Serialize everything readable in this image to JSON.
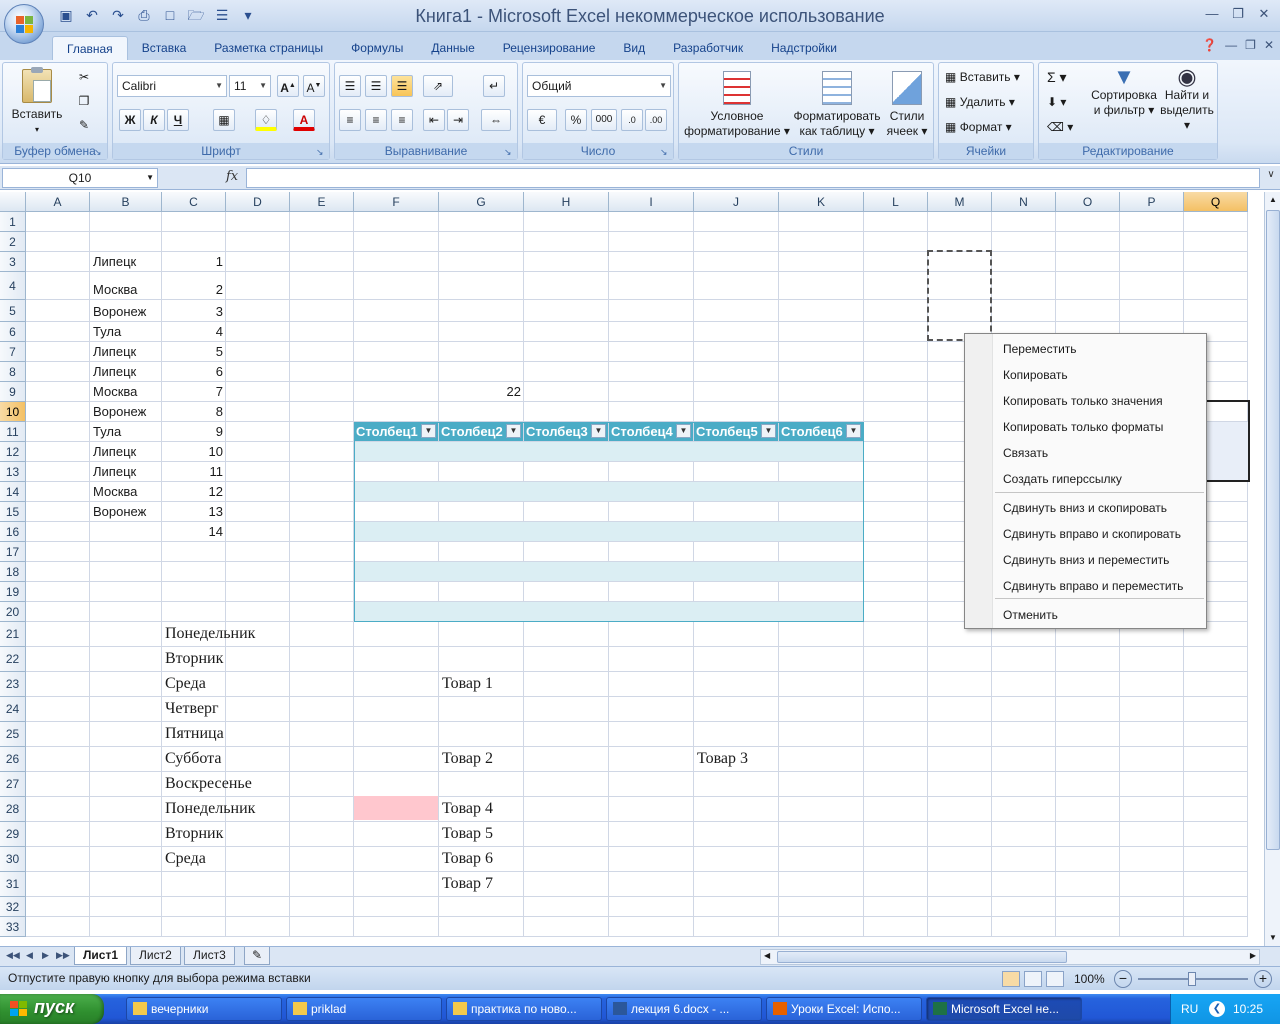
{
  "window": {
    "title": "Книга1 - Microsoft Excel некоммерческое использование"
  },
  "ribbon_tabs": [
    "Главная",
    "Вставка",
    "Разметка страницы",
    "Формулы",
    "Данные",
    "Рецензирование",
    "Вид",
    "Разработчик",
    "Надстройки"
  ],
  "ribbon": {
    "clipboard": {
      "paste": "Вставить",
      "label": "Буфер обмена"
    },
    "font": {
      "name": "Calibri",
      "size": "11",
      "bold": "Ж",
      "italic": "К",
      "underline": "Ч",
      "label": "Шрифт"
    },
    "alignment": {
      "label": "Выравнивание"
    },
    "number": {
      "format": "Общий",
      "percent": "%",
      "thousands": "000",
      "label": "Число"
    },
    "styles": {
      "conditional_1": "Условное",
      "conditional_2": "форматирование",
      "table_1": "Форматировать",
      "table_2": "как таблицу",
      "cell_1": "Стили",
      "cell_2": "ячеек",
      "label": "Стили"
    },
    "cells": {
      "insert": "Вставить",
      "delete": "Удалить",
      "format": "Формат",
      "label": "Ячейки"
    },
    "editing": {
      "sort_1": "Сортировка",
      "sort_2": "и фильтр",
      "find_1": "Найти и",
      "find_2": "выделить",
      "label": "Редактирование"
    }
  },
  "formula_bar": {
    "name_box": "Q10",
    "fx": "fx",
    "value": ""
  },
  "columns": [
    "A",
    "B",
    "C",
    "D",
    "E",
    "F",
    "G",
    "H",
    "I",
    "J",
    "K",
    "L",
    "M",
    "N",
    "O",
    "P",
    "Q"
  ],
  "selected_column": "Q",
  "selected_row": 10,
  "rows": [
    1,
    2,
    3,
    4,
    5,
    6,
    7,
    8,
    9,
    10,
    11,
    12,
    13,
    14,
    15,
    16,
    17,
    18,
    19,
    20,
    21,
    22,
    23,
    24,
    25,
    26,
    27,
    28,
    29,
    30,
    31,
    32,
    33
  ],
  "cells": {
    "B3": "Липецк",
    "C3": "1",
    "B4": "Москва",
    "C4": "2",
    "B5": "Воронеж",
    "C5": "3",
    "B6": "Тула",
    "C6": "4",
    "B7": "Липецк",
    "C7": "5",
    "B8": "Липецк",
    "C8": "6",
    "B9": "Москва",
    "C9": "7",
    "G9": "22",
    "B10": "Воронеж",
    "C10": "8",
    "B11": "Тула",
    "C11": "9",
    "B12": "Липецк",
    "C12": "10",
    "B13": "Липецк",
    "C13": "11",
    "B14": "Москва",
    "C14": "12",
    "B15": "Воронеж",
    "C15": "13",
    "C16": "14",
    "C21": "Понедельник",
    "C22": "Вторник",
    "C23": "Среда",
    "G23": "Товар 1",
    "C24": "Четверг",
    "C25": "Пятница",
    "C26": "Суббота",
    "G26": "Товар 2",
    "J26": "Товар 3",
    "C27": "Воскресенье",
    "C28": "Понедельник",
    "G28": "Товар 4",
    "C29": "Вторник",
    "G29": "Товар 5",
    "C30": "Среда",
    "G30": "Товар 6",
    "G31": "Товар 7"
  },
  "table_headers": [
    "Столбец1",
    "Столбец2",
    "Столбец3",
    "Столбец4",
    "Столбец5",
    "Столбец6"
  ],
  "context_menu": {
    "items": [
      "Переместить",
      "Копировать",
      "Копировать только значения",
      "Копировать только форматы",
      "Связать",
      "Создать гиперссылку",
      "Сдвинуть вниз и скопировать",
      "Сдвинуть вправо и скопировать",
      "Сдвинуть вниз и переместить",
      "Сдвинуть вправо и переместить",
      "Отменить"
    ]
  },
  "sheet_tabs": [
    "Лист1",
    "Лист2",
    "Лист3"
  ],
  "status": {
    "text": "Отпустите правую кнопку для выбора режима вставки",
    "zoom": "100%"
  },
  "taskbar": {
    "start": "пуск",
    "tasks": [
      "вечерники",
      "priklad",
      "практика по ново...",
      "лекция 6.docx - ...",
      "Уроки Excel: Испо...",
      "Microsoft Excel не..."
    ],
    "lang": "RU",
    "clock": "10:25"
  },
  "colors": {
    "table_header": "#4bacc6",
    "table_band": "#dbeef3",
    "pink_fill": "#ffc7ce",
    "selection": "#f4c064"
  }
}
